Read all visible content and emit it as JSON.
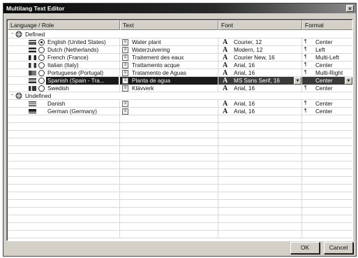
{
  "window": {
    "title": "Multilang Text Editor",
    "close_glyph": "×"
  },
  "columns": [
    "Language / Role",
    "Text",
    "Font",
    "Format"
  ],
  "groups": [
    {
      "label": "Defined",
      "expander": "−",
      "rows": [
        {
          "lang": "English (United States)",
          "radio": true,
          "text": "Water plant",
          "font": "Courier, 12",
          "format": "Center"
        },
        {
          "lang": "Dutch (Netherlands)",
          "radio": false,
          "text": "Waterzuivering",
          "font": "Modern, 12",
          "format": "Left"
        },
        {
          "lang": "French (France)",
          "radio": false,
          "text": "Traitement des eaux",
          "font": "Courier New, 16",
          "format": "Multi-Left"
        },
        {
          "lang": "Italian (Italy)",
          "radio": false,
          "text": "Trattamento acque",
          "font": "Arial, 16",
          "format": "Center"
        },
        {
          "lang": "Portuguese (Portugal)",
          "radio": false,
          "text": "Tratamento de Aguas",
          "font": "Arial, 16",
          "format": "Multi-Right"
        },
        {
          "lang": "Spanish (Spain - Tra...",
          "radio": false,
          "text": "Planta de agua",
          "font": "MS Sans Serif, 16",
          "format": "Center",
          "selected": true
        },
        {
          "lang": "Swedish",
          "radio": false,
          "text": "Klävverk",
          "font": "Arial, 16",
          "format": "Center"
        }
      ]
    },
    {
      "label": "Undefined",
      "expander": "−",
      "rows": [
        {
          "lang": "Danish",
          "text": "",
          "font": "Arial, 16",
          "format": "Center"
        },
        {
          "lang": "German (Germany)",
          "text": "",
          "font": "Arial, 16",
          "format": "Center"
        }
      ]
    }
  ],
  "icons": {
    "font": "A",
    "text": "≡",
    "format": "¶"
  },
  "buttons": {
    "ok": "OK",
    "cancel": "Cancel"
  },
  "colors": {
    "titlebar": "#0a0a0a",
    "selection": "#1a1a1a",
    "face": "#d4d0c8"
  }
}
